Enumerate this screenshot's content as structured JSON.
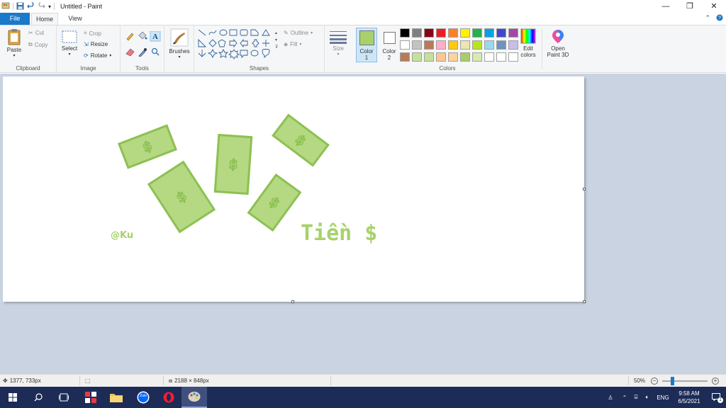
{
  "window": {
    "title": "Untitled - Paint",
    "minimize": "—",
    "restore": "❐",
    "close": "✕"
  },
  "tabs": {
    "file": "File",
    "home": "Home",
    "view": "View"
  },
  "ribbon": {
    "clipboard": {
      "label": "Clipboard",
      "paste": "Paste",
      "cut": "Cut",
      "copy": "Copy"
    },
    "image": {
      "label": "Image",
      "select": "Select",
      "crop": "Crop",
      "resize": "Resize",
      "rotate": "Rotate"
    },
    "tools": {
      "label": "Tools"
    },
    "brushes": {
      "label": "Brushes"
    },
    "shapes": {
      "label": "Shapes",
      "outline": "Outline",
      "fill": "Fill"
    },
    "size": {
      "label": "Size"
    },
    "colors": {
      "label": "Colors",
      "color1": "Color 1",
      "color1_line1": "Color",
      "color1_line2": "1",
      "color2_line1": "Color",
      "color2_line2": "2",
      "color1_value": "#a8d16c",
      "color2_value": "#ffffff",
      "edit_line1": "Edit",
      "edit_line2": "colors",
      "paint3d_line1": "Open",
      "paint3d_line2": "Paint 3D",
      "palette_row1": [
        "#000000",
        "#7f7f7f",
        "#880015",
        "#ed1c24",
        "#ff7f27",
        "#fff200",
        "#22b14c",
        "#00a2e8",
        "#3f48cc",
        "#a349a4"
      ],
      "palette_row2": [
        "#ffffff",
        "#c3c3c3",
        "#b97a57",
        "#ffaec9",
        "#ffc90e",
        "#efe4b0",
        "#b5e61d",
        "#99d9ea",
        "#7092be",
        "#c8bfe7"
      ],
      "palette_row3": [
        "#b97a57",
        "#c5e09a",
        "#c5e09a",
        "#ffc58f",
        "#ffd39b",
        "#a7cc6a",
        "#d8eab0",
        "#ffffff",
        "#ffffff",
        "#ffffff"
      ]
    }
  },
  "canvas": {
    "watermark": "@Ku",
    "caption": "Tiền $",
    "accent": "#a8d16c",
    "stroke": "#8cc152",
    "bill_symbol": "$"
  },
  "status": {
    "cursor_pos": "1377, 733px",
    "image_size": "2188 × 848px",
    "zoom": "50%"
  },
  "taskbar": {
    "time": "9:58 AM",
    "date": "6/5/2021",
    "lang": "ENG",
    "notif_count": "1",
    "zalo": "Zalo"
  }
}
